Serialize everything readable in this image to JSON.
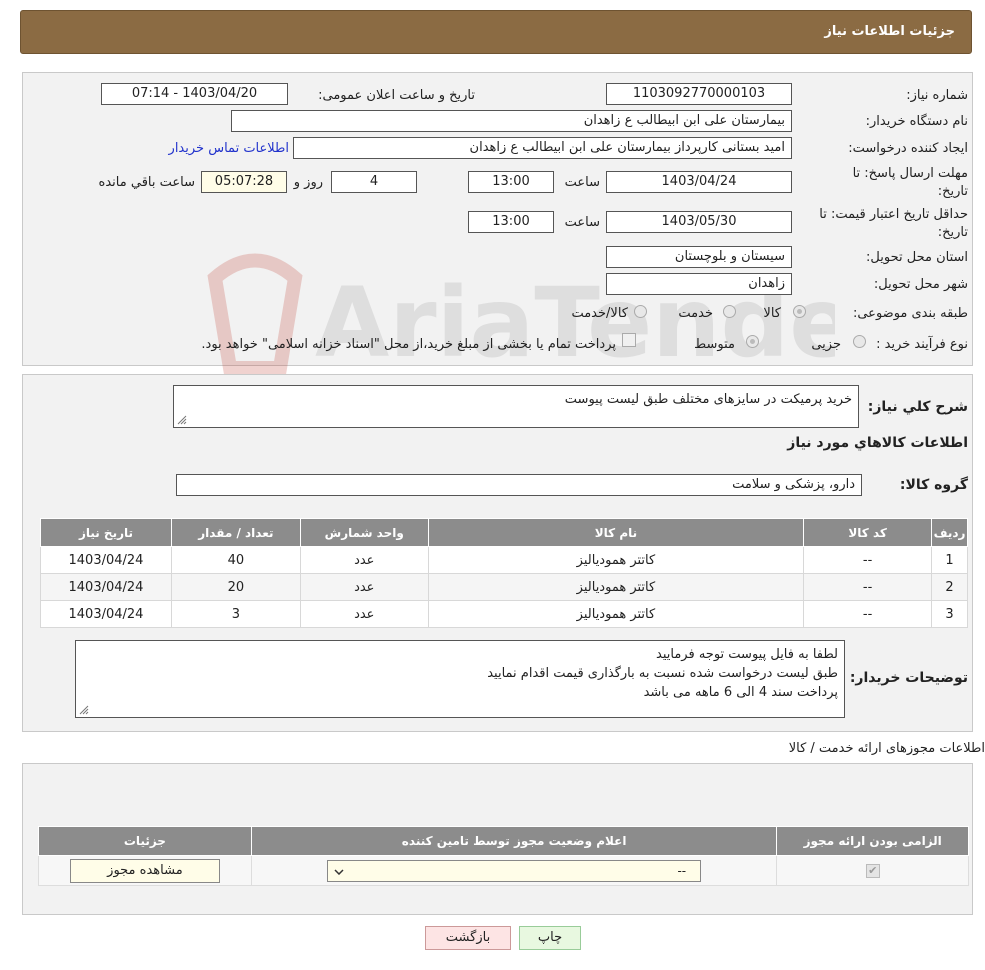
{
  "header": {
    "title": "جزئیات اطلاعات نیاز"
  },
  "form": {
    "need_number_label": "شماره نیاز:",
    "need_number": "1103092770000103",
    "announce_label": "تاریخ و ساعت اعلان عمومی:",
    "announce_value": "1403/04/20 - 07:14",
    "buyer_org_label": "نام دستگاه خریدار:",
    "buyer_org": "بیمارستان علی ابن ابیطالب  ع  زاهدان",
    "creator_label": "ایجاد کننده درخواست:",
    "creator": "امید بستانی کارپرداز  بیمارستان علی ابن ابیطالب  ع  زاهدان",
    "contact_link": "اطلاعات تماس خریدار",
    "deadline_label_1": "مهلت ارسال پاسخ: تا",
    "deadline_label_2": "تاریخ:",
    "deadline_date": "1403/04/24",
    "hour_label": "ساعت",
    "deadline_time": "13:00",
    "days_value": "4",
    "days_label": "روز و",
    "remaining_time": "05:07:28",
    "remaining_label": "ساعت باقي مانده",
    "validity_label_1": "حداقل تاریخ اعتبار قیمت: تا",
    "validity_label_2": "تاریخ:",
    "validity_date": "1403/05/30",
    "validity_time": "13:00",
    "province_label": "استان محل تحویل:",
    "province": "سیستان و بلوچستان",
    "city_label": "شهر محل تحویل:",
    "city": "زاهدان",
    "category_label": "طبقه بندی موضوعی:",
    "category_options": [
      "کالا",
      "خدمت",
      "کالا/خدمت"
    ],
    "purchase_type_label": "نوع فرآیند خرید :",
    "purchase_options": [
      "جزیی",
      "متوسط"
    ],
    "purchase_note": "پرداخت تمام یا بخشی از مبلغ خرید،از محل \"اسناد خزانه اسلامی\" خواهد بود."
  },
  "description": {
    "label": "شرح كلي نياز:",
    "value": "خرید پرمیکت در سایزهای مختلف طبق لیست پیوست",
    "goods_info_title": "اطلاعات كالاهاي مورد نياز",
    "group_label": "گروه کالا:",
    "group_value": "دارو، پزشکی و سلامت"
  },
  "items_table": {
    "headers": [
      "ردیف",
      "کد کالا",
      "نام کالا",
      "واحد شمارش",
      "تعداد / مقدار",
      "تاریخ نیاز"
    ],
    "rows": [
      [
        "1",
        "--",
        "کاتتر همودیالیز",
        "عدد",
        "40",
        "1403/04/24"
      ],
      [
        "2",
        "--",
        "کاتتر همودیالیز",
        "عدد",
        "20",
        "1403/04/24"
      ],
      [
        "3",
        "--",
        "کاتتر همودیالیز",
        "عدد",
        "3",
        "1403/04/24"
      ]
    ]
  },
  "buyer_notes": {
    "label": "توضیحات خریدار:",
    "lines": [
      "لطفا به فایل پیوست توجه فرمایید",
      "طبق لیست درخواست شده نسبت به بارگذاری قیمت اقدام نمایید",
      "پرداخت سند 4 الی 6 ماهه می باشد"
    ]
  },
  "licenses": {
    "title": "اطلاعات مجوزهای ارائه خدمت / کالا",
    "headers": [
      "الزامی بودن ارائه مجوز",
      "اعلام وضعیت مجوز توسط تامین کننده",
      "جزئیات"
    ],
    "select_value": "--",
    "view_button": "مشاهده مجوز"
  },
  "buttons": {
    "print": "چاپ",
    "back": "بازگشت"
  },
  "watermark": {
    "text": "AriaTender.neT"
  },
  "colors": {
    "header": "#8b6b43",
    "link": "#2233cc",
    "print_btn": "#e8f8e0",
    "back_btn": "#fde4e4"
  }
}
